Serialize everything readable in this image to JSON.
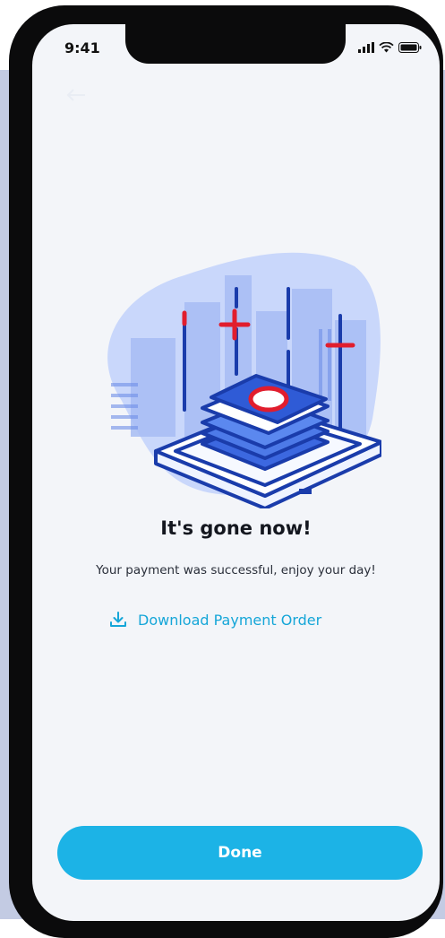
{
  "status_bar": {
    "time": "9:41",
    "icons": [
      "signal-icon",
      "wifi-icon",
      "battery-icon"
    ]
  },
  "illustration": {
    "icon": "payment-sent-illustration",
    "colors": {
      "blob": "#c5d4fb",
      "buildings": "#a9bff4",
      "line": "#1a3cab",
      "money": "#3c68e0",
      "accent": "#e11d2d"
    }
  },
  "main": {
    "title": "It's gone now!",
    "message": "Your payment was successful, enjoy your day!",
    "download_link": {
      "icon": "download-icon",
      "label": "Download Payment Order"
    }
  },
  "footer": {
    "done_label": "Done"
  },
  "colors": {
    "accent": "#1cb3e6",
    "link": "#15a6d8",
    "screen_bg": "#f3f5f9",
    "text": "#14171f"
  }
}
